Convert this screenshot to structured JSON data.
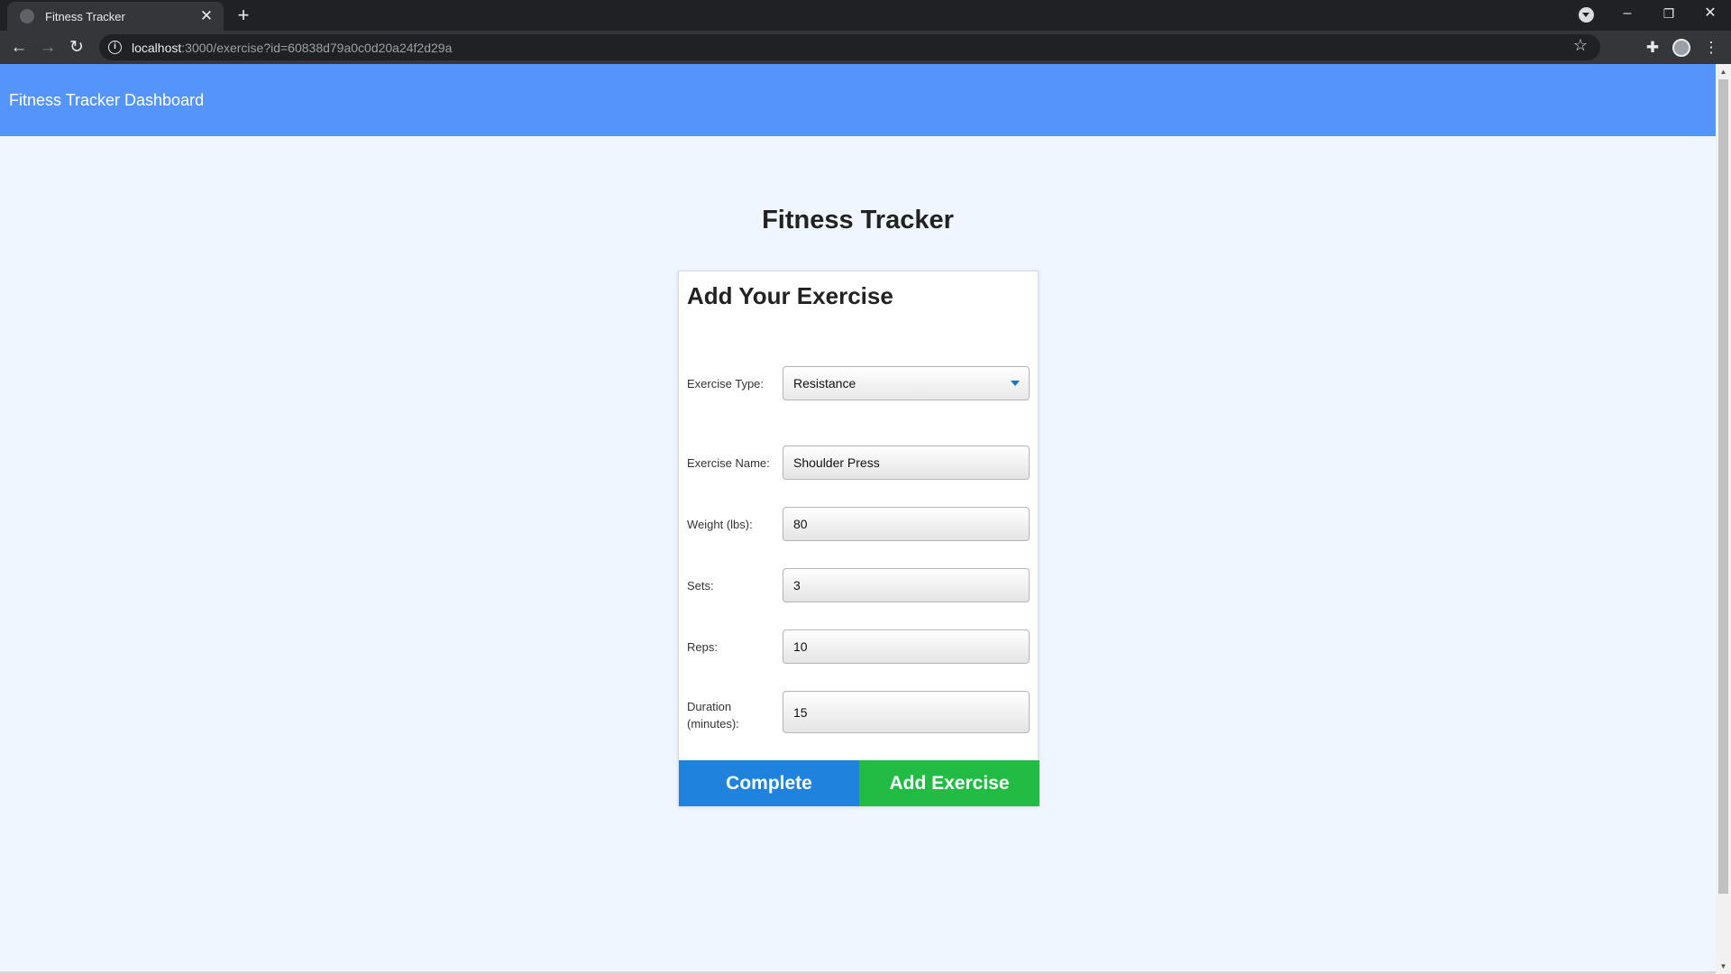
{
  "browser": {
    "tab_title": "Fitness Tracker",
    "tab_close": "✕",
    "new_tab": "+",
    "url_host": "localhost",
    "url_path": ":3000/exercise?id=60838d79a0c0d20a24f2d29a",
    "window_controls": {
      "minimize": "–",
      "restore": "❐",
      "close": "✕"
    },
    "nav": {
      "back": "←",
      "forward": "→",
      "reload": "↻"
    },
    "icons": {
      "info": "i",
      "star": "☆",
      "extensions": "✚",
      "menu": "⋮"
    }
  },
  "header": {
    "brand": "Fitness Tracker Dashboard"
  },
  "main": {
    "title": "Fitness Tracker"
  },
  "form": {
    "title": "Add Your Exercise",
    "type": {
      "label": "Exercise Type:",
      "value": "Resistance"
    },
    "name": {
      "label": "Exercise Name:",
      "value": "Shoulder Press"
    },
    "weight": {
      "label": "Weight (lbs):",
      "value": "80"
    },
    "sets": {
      "label": "Sets:",
      "value": "3"
    },
    "reps": {
      "label": "Reps:",
      "value": "10"
    },
    "duration": {
      "label": "Duration (minutes):",
      "value": "15"
    }
  },
  "buttons": {
    "complete": "Complete",
    "add": "Add Exercise"
  },
  "colors": {
    "header": "#5594fb",
    "complete_button": "#1f82dc",
    "add_button": "#22bb44",
    "page_background": "#f0f6ff"
  }
}
